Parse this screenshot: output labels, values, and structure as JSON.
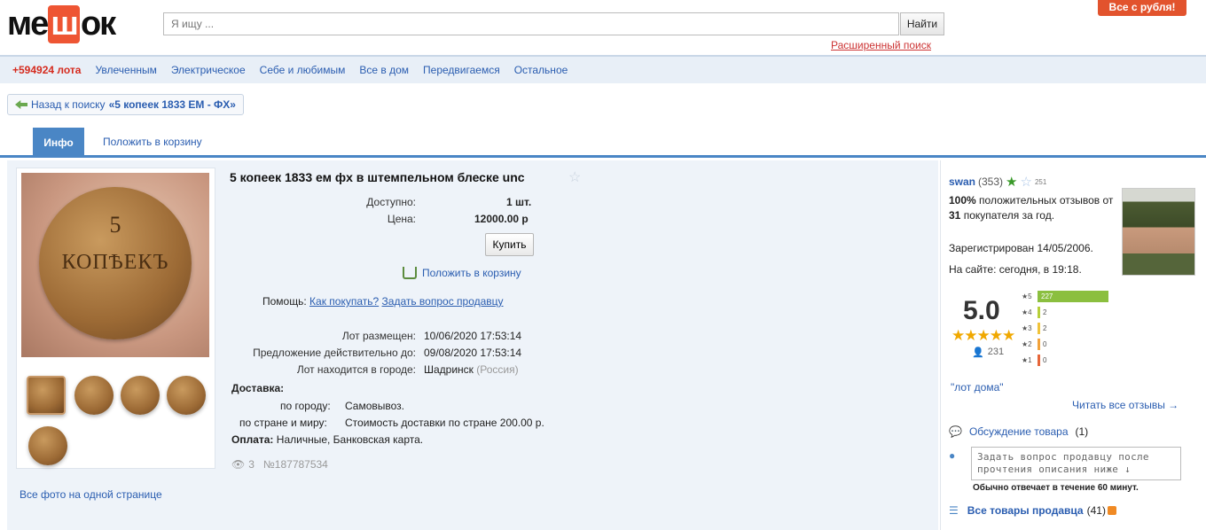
{
  "header": {
    "logo": {
      "before": "ме",
      "highlight": "ш",
      "after": "ок"
    },
    "search_placeholder": "Я ищу ...",
    "search_button": "Найти",
    "advanced_search": "Расширенный поиск",
    "promo": "Все с рубля!"
  },
  "nav": {
    "count": "+594924 лота",
    "items": [
      "Увлеченным",
      "Электрическое",
      "Себе и любимым",
      "Все в дом",
      "Передвигаемся",
      "Остальное"
    ]
  },
  "back": {
    "label": "Назад к поиску",
    "query": "«5 копеек 1833 ЕМ - ФХ»"
  },
  "tabs": {
    "info": "Инфо",
    "cart": "Положить в корзину"
  },
  "gallery": {
    "all_photos": "Все фото на одной странице",
    "coin_text_1": "5",
    "coin_text_2": "КОПѢЕКЪ"
  },
  "lot": {
    "title": "5 копеек 1833 ем фх в штемпельном блеске unc",
    "available_label": "Доступно:",
    "available_value": "1 шт.",
    "price_label": "Цена:",
    "price_value": "12000.00 р",
    "buy_button": "Купить",
    "add_to_cart": "Положить в корзину",
    "help_label": "Помощь:",
    "help_how": "Как покупать?",
    "help_ask": "Задать вопрос продавцу",
    "placed_label": "Лот размещен:",
    "placed_value": "10/06/2020 17:53:14",
    "valid_label": "Предложение действительно до:",
    "valid_value": "09/08/2020 17:53:14",
    "city_label": "Лот находится в городе:",
    "city_value": "Шадринск",
    "city_country": "(Россия)",
    "delivery_label": "Доставка:",
    "delivery_city_label": "по городу:",
    "delivery_city_value": "Самовывоз.",
    "delivery_world_label": "по стране и миру:",
    "delivery_world_value": "Стоимость доставки по стране 200.00 р.",
    "payment_label": "Оплата:",
    "payment_value": "Наличные, Банковская карта.",
    "views": "3",
    "lot_number": "№187787534"
  },
  "seller": {
    "name": "swan",
    "count": "(353)",
    "stars_small": "251",
    "positive_pct": "100%",
    "positive_text_1": "положительных",
    "positive_text_2": "отзывов от",
    "positive_count": "31",
    "positive_text_3": "покупателя за",
    "positive_text_4": "год.",
    "registered": "Зарегистрирован 14/05/2006.",
    "online": "На сайте: сегодня, в 19:18.",
    "score": "5.0",
    "reviews_count": "231",
    "rating_rows": [
      {
        "stars": "5",
        "count": "227",
        "color": "#8bbf3f"
      },
      {
        "stars": "4",
        "count": "2",
        "color": "#b7cf3a"
      },
      {
        "stars": "3",
        "count": "2",
        "color": "#f0c33a"
      },
      {
        "stars": "2",
        "count": "0",
        "color": "#f2a23a"
      },
      {
        "stars": "1",
        "count": "0",
        "color": "#e6663a"
      }
    ],
    "home_lot": "\"лот дома\"",
    "read_all": "Читать все отзывы →",
    "discussion": "Обсуждение товара",
    "discussion_count": "(1)",
    "question_placeholder": "Задать вопрос продавцу после прочтения описания ниже ↓",
    "reply_time": "Обычно отвечает в течение 60 минут.",
    "all_goods": "Все товары продавца",
    "all_goods_count": "(41)"
  }
}
